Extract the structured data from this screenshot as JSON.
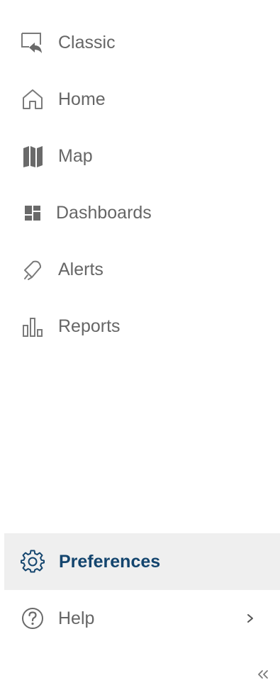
{
  "nav": {
    "items": [
      {
        "label": "Classic",
        "icon": "classic-view-icon"
      },
      {
        "label": "Home",
        "icon": "home-icon"
      },
      {
        "label": "Map",
        "icon": "map-icon"
      },
      {
        "label": "Dashboards",
        "icon": "dashboard-icon"
      },
      {
        "label": "Alerts",
        "icon": "alert-bell-icon"
      },
      {
        "label": "Reports",
        "icon": "bar-chart-icon"
      }
    ]
  },
  "footer": {
    "preferences": {
      "label": "Preferences",
      "icon": "gear-icon",
      "active": true
    },
    "help": {
      "label": "Help",
      "icon": "question-circle-icon",
      "has_submenu": true
    },
    "collapse_glyph": "«"
  },
  "colors": {
    "text": "#666666",
    "icon": "#7a7a7a",
    "active_text": "#14456e",
    "active_bg": "#efefef"
  }
}
